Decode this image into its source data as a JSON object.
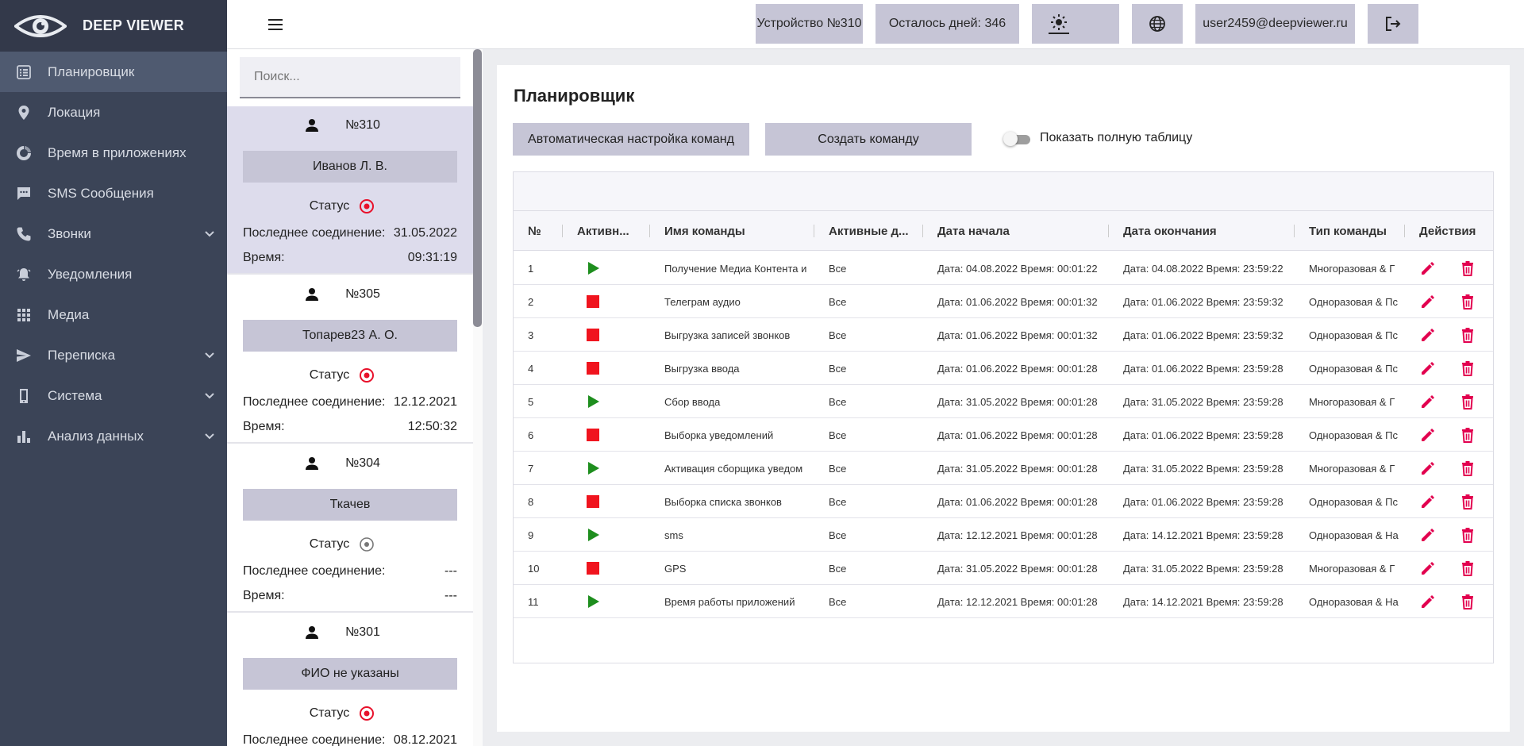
{
  "app": {
    "title": "DEEP VIEWER",
    "brand_color": "#3b4457",
    "accent_color": "#e2004f"
  },
  "sidebar": {
    "items": [
      {
        "label": "Планировщик",
        "icon": "list-icon",
        "active": true,
        "expandable": false
      },
      {
        "label": "Локация",
        "icon": "location-pin-icon",
        "active": false,
        "expandable": false
      },
      {
        "label": "Время в приложениях",
        "icon": "donut-chart-icon",
        "active": false,
        "expandable": false
      },
      {
        "label": "SMS Сообщения",
        "icon": "sms-bubble-icon",
        "active": false,
        "expandable": false
      },
      {
        "label": "Звонки",
        "icon": "phone-icon",
        "active": false,
        "expandable": true
      },
      {
        "label": "Уведомления",
        "icon": "bell-icon",
        "active": false,
        "expandable": false
      },
      {
        "label": "Медиа",
        "icon": "grid-icon",
        "active": false,
        "expandable": false
      },
      {
        "label": "Переписка",
        "icon": "send-icon",
        "active": false,
        "expandable": true
      },
      {
        "label": "Система",
        "icon": "smartphone-icon",
        "active": false,
        "expandable": true
      },
      {
        "label": "Анализ данных",
        "icon": "bar-chart-icon",
        "active": false,
        "expandable": true
      }
    ]
  },
  "header": {
    "device": "Устройство №310",
    "days_left": "Осталось дней: 346",
    "user": "user2459@deepviewer.ru"
  },
  "devices": {
    "search_placeholder": "Поиск...",
    "status_label": "Статус",
    "last_conn_label": "Последнее соединение:",
    "time_label": "Время:",
    "items": [
      {
        "number": "№310",
        "name": "Иванов Л. В.",
        "online": true,
        "last_conn": "31.05.2022",
        "time": "09:31:19",
        "selected": true
      },
      {
        "number": "№305",
        "name": "Топарев23 А. О.",
        "online": true,
        "last_conn": "12.12.2021",
        "time": "12:50:32",
        "selected": false
      },
      {
        "number": "№304",
        "name": "Ткачев",
        "online": false,
        "last_conn": "---",
        "time": "---",
        "selected": false
      },
      {
        "number": "№301",
        "name": "ФИО не указаны",
        "online": true,
        "last_conn": "08.12.2021",
        "time": "",
        "selected": false
      }
    ]
  },
  "main": {
    "title": "Планировщик",
    "auto_button": "Автоматическая настройка команд",
    "create_button": "Создать команду",
    "toggle_label": "Показать полную таблицу",
    "toggle_on": false,
    "columns": [
      "№",
      "Активн...",
      "Имя команды",
      "Активные д...",
      "Дата начала",
      "Дата окончания",
      "Тип команды",
      "Действия"
    ],
    "rows": [
      {
        "n": "1",
        "active": true,
        "name": "Получение Медиа Контента и",
        "days": "Все",
        "start": "Дата: 04.08.2022 Время: 00:01:22",
        "end": "Дата: 04.08.2022 Время: 23:59:22",
        "type": "Многоразовая & Г"
      },
      {
        "n": "2",
        "active": false,
        "name": "Телеграм аудио",
        "days": "Все",
        "start": "Дата: 01.06.2022 Время: 00:01:32",
        "end": "Дата: 01.06.2022 Время: 23:59:32",
        "type": "Одноразовая & Пс"
      },
      {
        "n": "3",
        "active": false,
        "name": "Выгрузка записей звонков",
        "days": "Все",
        "start": "Дата: 01.06.2022 Время: 00:01:32",
        "end": "Дата: 01.06.2022 Время: 23:59:32",
        "type": "Одноразовая & Пс"
      },
      {
        "n": "4",
        "active": false,
        "name": "Выгрузка ввода",
        "days": "Все",
        "start": "Дата: 01.06.2022 Время: 00:01:28",
        "end": "Дата: 01.06.2022 Время: 23:59:28",
        "type": "Одноразовая & Пс"
      },
      {
        "n": "5",
        "active": true,
        "name": "Сбор ввода",
        "days": "Все",
        "start": "Дата: 31.05.2022 Время: 00:01:28",
        "end": "Дата: 31.05.2022 Время: 23:59:28",
        "type": "Многоразовая & Г"
      },
      {
        "n": "6",
        "active": false,
        "name": "Выборка уведомлений",
        "days": "Все",
        "start": "Дата: 01.06.2022 Время: 00:01:28",
        "end": "Дата: 01.06.2022 Время: 23:59:28",
        "type": "Одноразовая & Пс"
      },
      {
        "n": "7",
        "active": true,
        "name": "Активация сборщика уведом",
        "days": "Все",
        "start": "Дата: 31.05.2022 Время: 00:01:28",
        "end": "Дата: 31.05.2022 Время: 23:59:28",
        "type": "Многоразовая & Г"
      },
      {
        "n": "8",
        "active": false,
        "name": "Выборка списка звонков",
        "days": "Все",
        "start": "Дата: 01.06.2022 Время: 00:01:28",
        "end": "Дата: 01.06.2022 Время: 23:59:28",
        "type": "Одноразовая & Пс"
      },
      {
        "n": "9",
        "active": true,
        "name": "sms",
        "days": "Все",
        "start": "Дата: 12.12.2021 Время: 00:01:28",
        "end": "Дата: 14.12.2021 Время: 23:59:28",
        "type": "Одноразовая & На"
      },
      {
        "n": "10",
        "active": false,
        "name": "GPS",
        "days": "Все",
        "start": "Дата: 31.05.2022 Время: 00:01:28",
        "end": "Дата: 31.05.2022 Время: 23:59:28",
        "type": "Многоразовая & Г"
      },
      {
        "n": "11",
        "active": true,
        "name": "Время работы приложений",
        "days": "Все",
        "start": "Дата: 12.12.2021 Время: 00:01:28",
        "end": "Дата: 14.12.2021 Время: 23:59:28",
        "type": "Одноразовая & На"
      }
    ]
  }
}
